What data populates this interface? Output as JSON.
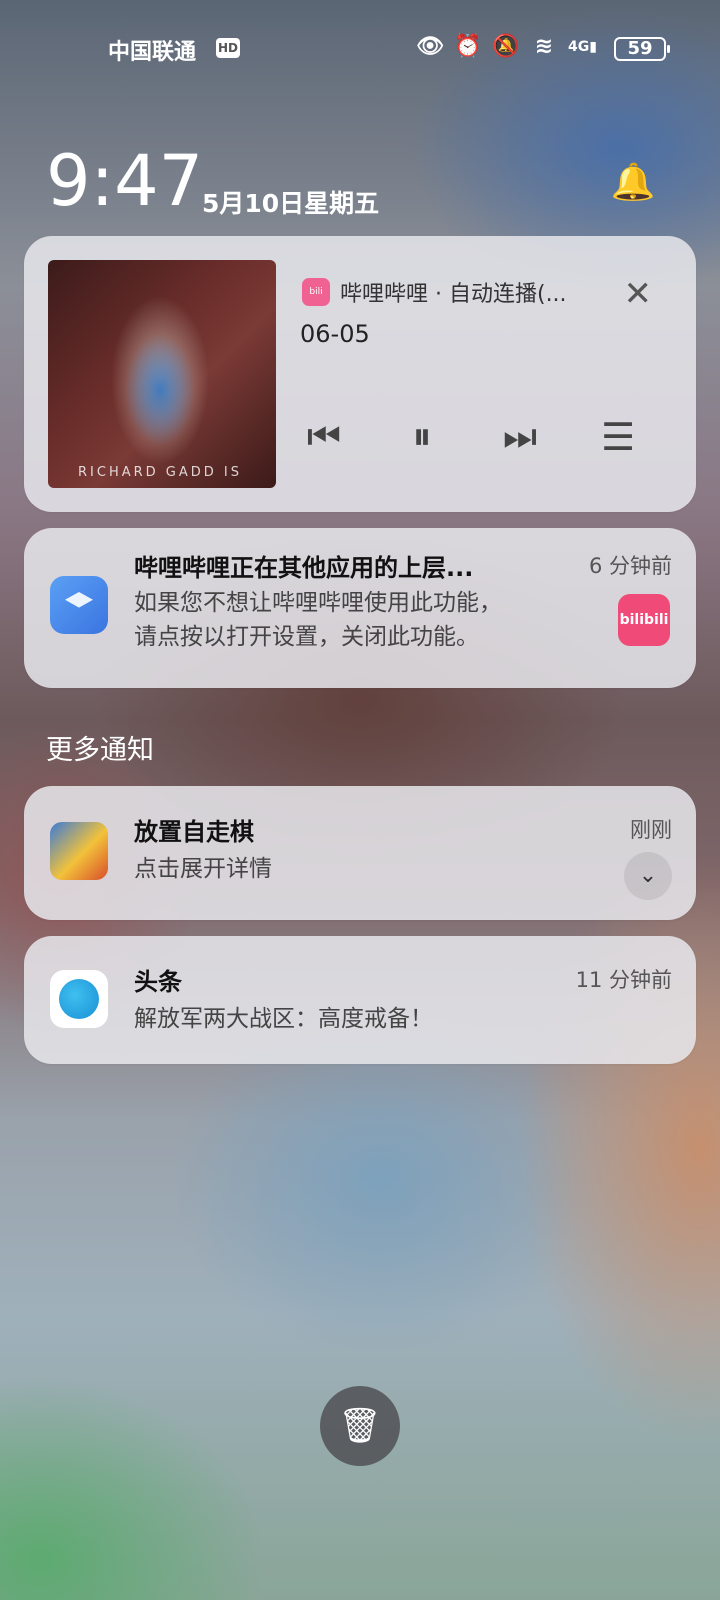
{
  "status_bar": {
    "carrier": "中国联通",
    "hd": "HD",
    "icons": [
      "eye-icon",
      "alarm-icon",
      "mute-bell-icon",
      "wifi-icon",
      "signal-4g-icon"
    ],
    "battery": "59"
  },
  "lockscreen": {
    "time": "9:47",
    "date": "5月10日星期五"
  },
  "media_card": {
    "app": "哔哩哔哩 · 自动连播(...",
    "title": "06-05",
    "album_caption": "RICHARD GADD IS",
    "controls": [
      "previous-icon",
      "pause-icon",
      "next-icon",
      "playlist-icon"
    ]
  },
  "notification_overlay": {
    "title": "哔哩哔哩正在其他应用的上层...",
    "time": "6 分钟前",
    "body_line1": "如果您不想让哔哩哔哩使用此功能，",
    "body_line2": "请点按以打开设置，关闭此功能。",
    "badge": "bilibili"
  },
  "section_title": "更多通知",
  "notification_game": {
    "title": "放置自走棋",
    "time": "刚刚",
    "body": "点击展开详情"
  },
  "notification_toutiao": {
    "title": "头条",
    "time": "11 分钟前",
    "body": "解放军两大战区：高度戒备！"
  },
  "colors": {
    "card_bg": "#e6e6eb",
    "bilibili_pink": "#f04a78"
  }
}
